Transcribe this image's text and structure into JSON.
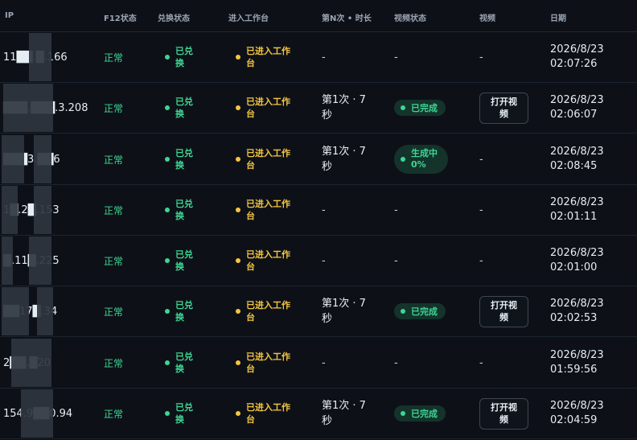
{
  "headers": {
    "ip": "IP",
    "f12": "F12状态",
    "exchange": "兑换状态",
    "workbench": "进入工作台",
    "nth": "第N次 • 时长",
    "video_status": "视频状态",
    "video": "视频",
    "date": "日期"
  },
  "colors": {
    "green": "#3ed694",
    "yellow": "#f5c542",
    "background": "#0d1117"
  },
  "rows": [
    {
      "ip": "11██.█.166",
      "f12": "正常",
      "exchange": "已兑换",
      "workbench": "已进入工作台",
      "nth": "-",
      "video_status": "-",
      "video": "-",
      "date": "2026/8/23 02:07:26"
    },
    {
      "ip": "███.███.3.208",
      "f12": "正常",
      "exchange": "已兑换",
      "workbench": "已进入工作台",
      "nth": "第1次 · 7秒",
      "video_status": "已完成",
      "video": "打开视频",
      "date": "2026/8/23 02:06:07"
    },
    {
      "ip": "███3.██6",
      "f12": "正常",
      "exchange": "已兑换",
      "workbench": "已进入工作台",
      "nth": "第1次 · 7秒",
      "video_status": "生成中 0%",
      "video": "-",
      "date": "2026/8/23 02:08:45"
    },
    {
      "ip": "1█.2█.153",
      "f12": "正常",
      "exchange": "已兑换",
      "workbench": "已进入工作台",
      "nth": "-",
      "video_status": "-",
      "video": "-",
      "date": "2026/8/23 02:01:11"
    },
    {
      "ip": "█.11█.225",
      "f12": "正常",
      "exchange": "已兑换",
      "workbench": "已进入工作台",
      "nth": "-",
      "video_status": "-",
      "video": "-",
      "date": "2026/8/23 02:01:00"
    },
    {
      "ip": "██17█.34",
      "f12": "正常",
      "exchange": "已兑换",
      "workbench": "已进入工作台",
      "nth": "第1次 · 7秒",
      "video_status": "已完成",
      "video": "打开视频",
      "date": "2026/8/23 02:02:53"
    },
    {
      "ip": "2██.█20",
      "f12": "正常",
      "exchange": "已兑换",
      "workbench": "已进入工作台",
      "nth": "-",
      "video_status": "-",
      "video": "-",
      "date": "2026/8/23 01:59:56"
    },
    {
      "ip": "154.9██0.94",
      "f12": "正常",
      "exchange": "已兑换",
      "workbench": "已进入工作台",
      "nth": "第1次 · 7秒",
      "video_status": "已完成",
      "video": "打开视频",
      "date": "2026/8/23 02:04:59"
    }
  ]
}
